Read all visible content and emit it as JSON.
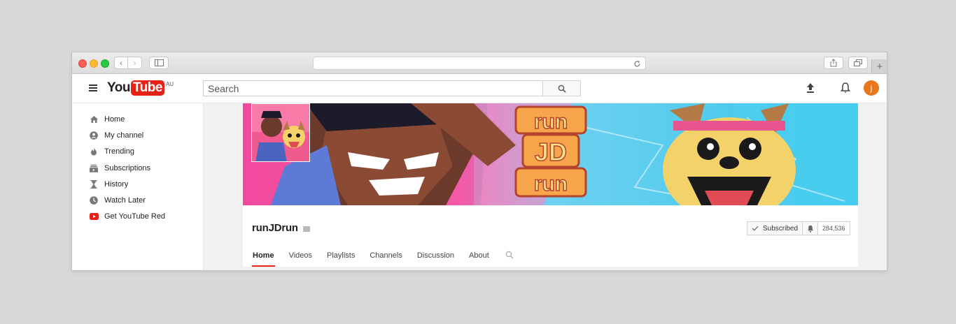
{
  "browser": {
    "nav": {
      "back": "‹",
      "forward": "›"
    },
    "new_tab": "+"
  },
  "header": {
    "logo_you": "You",
    "logo_tube": "Tube",
    "region": "AU",
    "search_placeholder": "Search",
    "avatar_letter": "j"
  },
  "sidebar": {
    "items": [
      {
        "label": "Home",
        "icon": "home-icon"
      },
      {
        "label": "My channel",
        "icon": "user-icon"
      },
      {
        "label": "Trending",
        "icon": "flame-icon"
      },
      {
        "label": "Subscriptions",
        "icon": "subscriptions-icon"
      },
      {
        "label": "History",
        "icon": "hourglass-icon"
      },
      {
        "label": "Watch Later",
        "icon": "clock-icon"
      },
      {
        "label": "Get YouTube Red",
        "icon": "youtube-red-icon"
      }
    ]
  },
  "banner": {
    "text_lines": [
      "run",
      "JD",
      "run"
    ]
  },
  "channel": {
    "name": "runJDrun",
    "subscribed_label": "Subscribed",
    "subscriber_count": "284,536",
    "tabs": [
      "Home",
      "Videos",
      "Playlists",
      "Channels",
      "Discussion",
      "About"
    ]
  },
  "colors": {
    "accent": "#e62117",
    "avatar": "#e8761a",
    "banner_pink": "#f0479a",
    "banner_cyan": "#38c6ea"
  }
}
